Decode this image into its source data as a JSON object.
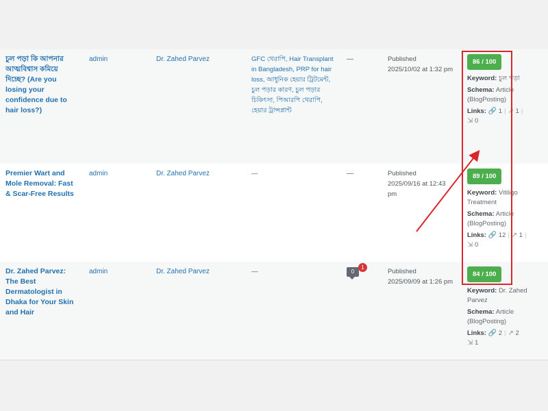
{
  "rows": [
    {
      "title": "চুল পড়া কি আপনার আত্মবিশ্বাস কমিয়ে দিচ্ছে? (Are you losing your confidence due to hair loss?)",
      "author": "admin",
      "doctor": "Dr. Zahed Parvez",
      "tags": "GFC থেরাপি, Hair Transplant in Bangladesh, PRP for hair loss, আধুনিক হেয়ার ট্রিটমেন্ট, চুল পড়ার কারণ, চুল পড়ার চিকিৎসা, পিআরপি থেরাপি, হেয়ার ট্রান্সপ্লান্ট",
      "comments": "—",
      "status": "Published",
      "date": "2025/10/02 at 1:32 pm",
      "score": "86 / 100",
      "keyword_label": "Keyword:",
      "keyword": "চুল পড়া",
      "schema_label": "Schema:",
      "schema": "Article (BlogPosting)",
      "links_label": "Links:",
      "internal": "1",
      "external": "1",
      "incoming": "0"
    },
    {
      "title": "Premier Wart and Mole Removal: Fast & Scar-Free Results",
      "author": "admin",
      "doctor": "Dr. Zahed Parvez",
      "tags": "—",
      "comments": "—",
      "status": "Published",
      "date": "2025/09/16 at 12:43 pm",
      "score": "89 / 100",
      "keyword_label": "Keyword:",
      "keyword": "Vitiligo Treatment",
      "schema_label": "Schema:",
      "schema": "Article (BlogPosting)",
      "links_label": "Links:",
      "internal": "12",
      "external": "1",
      "incoming": "0"
    },
    {
      "title": "Dr. Zahed Parvez: The Best Dermatologist in Dhaka for Your Skin and Hair",
      "author": "admin",
      "doctor": "Dr. Zahed Parvez",
      "tags": "—",
      "comment_count": "0",
      "pending_count": "1",
      "status": "Published",
      "date": "2025/09/09 at 1:26 pm",
      "score": "84 / 100",
      "keyword_label": "Keyword:",
      "keyword": "Dr. Zahed Parvez",
      "schema_label": "Schema:",
      "schema": "Article (BlogPosting)",
      "links_label": "Links:",
      "internal": "2",
      "external": "2",
      "incoming": "1"
    }
  ],
  "icons": {
    "internal": "link-icon",
    "external": "external-link-icon",
    "incoming": "incoming-link-icon"
  },
  "colors": {
    "score": "#4cae4c",
    "link": "#2271b1",
    "annotation": "#d9262c"
  }
}
